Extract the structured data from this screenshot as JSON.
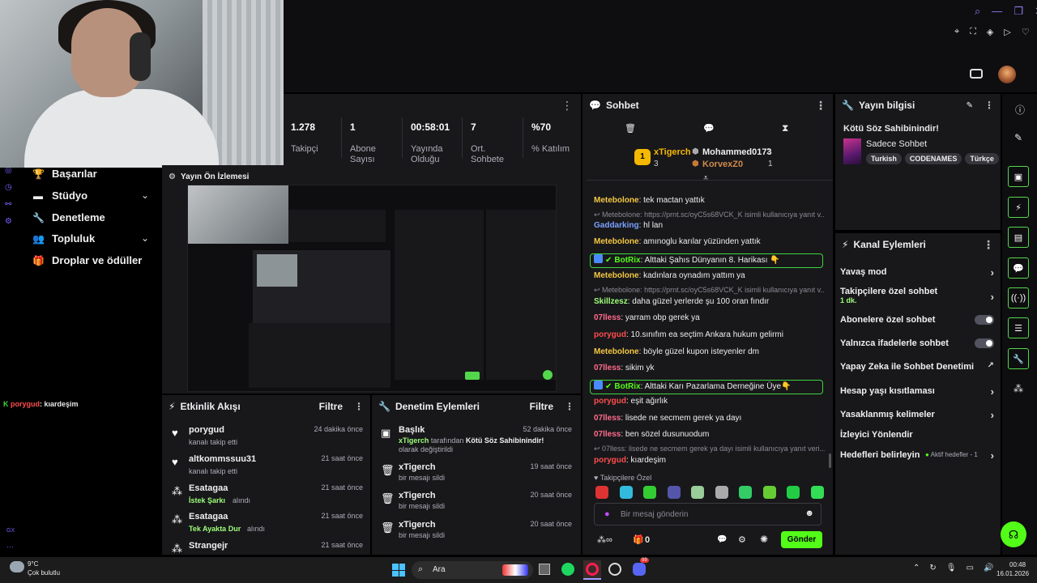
{
  "stats": [
    {
      "value": "1.278",
      "label": "Takipçi"
    },
    {
      "value": "1",
      "label": "Abone Sayısı"
    },
    {
      "value": "00:58:01",
      "label": "Yayında Olduğu"
    },
    {
      "value": "7",
      "label": "Ort. Sohbete"
    },
    {
      "value": "%70",
      "label": "% Katılım"
    }
  ],
  "nav": {
    "items": [
      {
        "label": "Başarılar",
        "icon": "trophy-icon"
      },
      {
        "label": "Stüdyo",
        "icon": "video-icon"
      },
      {
        "label": "Denetleme",
        "icon": "wrench-icon"
      },
      {
        "label": "Topluluk",
        "icon": "people-icon"
      },
      {
        "label": "Droplar ve ödüller",
        "icon": "gift-icon"
      }
    ]
  },
  "preview": {
    "title": "Yayın Ön İzlemesi"
  },
  "overlay_chat": {
    "user": "porygud",
    "text": ": kıardeşim"
  },
  "overlay_small": "GX",
  "activity": {
    "title": "Etkinlik Akışı",
    "filter": "Filtre",
    "rows": [
      {
        "name": "porygud",
        "sub": "kanalı takip etti",
        "time": "24 dakika önce",
        "icon": "heart-icon"
      },
      {
        "name": "altkommssuu31",
        "sub": "kanalı takip etti",
        "time": "21 saat önce",
        "icon": "heart-icon"
      },
      {
        "name": "Esatagaa",
        "sub_green": "İstek Şarkı",
        "sub": "alındı",
        "time": "21 saat önce",
        "icon": "points-icon"
      },
      {
        "name": "Esatagaa",
        "sub_green": "Tek Ayakta Dur",
        "sub": "alındı",
        "time": "21 saat önce",
        "icon": "points-icon"
      },
      {
        "name": "Strangejr",
        "sub": "",
        "time": "21 saat önce",
        "icon": "points-icon"
      }
    ]
  },
  "moderation": {
    "title": "Denetim Eylemleri",
    "filter": "Filtre",
    "rows": [
      {
        "name": "Başlık",
        "user": "xTigerch",
        "mid": " tarafından ",
        "bold": "Kötü Söz Sahibinindir!",
        "end": " olarak değiştirildi",
        "time": "52 dakika önce",
        "icon": "title-icon"
      },
      {
        "name": "xTigerch",
        "sub": "bir mesajı sildi",
        "time": "19 saat önce",
        "icon": "trash-icon"
      },
      {
        "name": "xTigerch",
        "sub": "bir mesajı sildi",
        "time": "20 saat önce",
        "icon": "trash-icon"
      },
      {
        "name": "xTigerch",
        "sub": "bir mesajı sildi",
        "time": "20 saat önce",
        "icon": "trash-icon"
      }
    ]
  },
  "chat": {
    "title": "Sohbet",
    "leaders": {
      "first": "xTigerch",
      "first_count": "3",
      "second": "Mohammed0173",
      "second_count": "2",
      "third": "KorvexZ0",
      "third_count": "1"
    },
    "messages": [
      {
        "user": "Metebolone",
        "color": "#f5c842",
        "text": ": tek mactan yattık"
      },
      {
        "reply": "Metebolone: https://prnt.sc/oyC5s68VCK_K isimli kullanıcıya yanıt v..."
      },
      {
        "user": "Gaddarking",
        "color": "#7aa2ff",
        "text": ": hl lan"
      },
      {
        "user": "Metebolone",
        "color": "#f5c842",
        "text": ": amınoglu karılar yüzünden yattık"
      },
      {
        "bot": "BotRix",
        "text": ": Alttaki Şahıs Dünyanın 8. Harikası 👇"
      },
      {
        "user": "Metebolone",
        "color": "#f5c842",
        "text": ": kadınlara oynadım yattım ya"
      },
      {
        "reply": "Metebolone: https://prnt.sc/oyC5s68VCK_K isimli kullanıcıya yanıt v..."
      },
      {
        "user": "Skillzesz",
        "color": "#9dff7a",
        "text": ": daha güzel yerlerde şu 100 oran fındır"
      },
      {
        "user": "07lless",
        "color": "#ff6b8b",
        "text": ": yarram obp gerek ya"
      },
      {
        "user": "porygud",
        "color": "#ff4d4d",
        "text": ": 10.sınıfım ea seçtim Ankara hukum gelirmi"
      },
      {
        "user": "Metebolone",
        "color": "#f5c842",
        "text": ": böyle güzel kupon isteyenler dm"
      },
      {
        "user": "07lless",
        "color": "#ff6b8b",
        "text": ": sikim yk"
      },
      {
        "bot": "BotRix",
        "text": ": Alttaki Karı Pazarlama Derneğine Üye👇"
      },
      {
        "user": "porygud",
        "color": "#ff4d4d",
        "text": ": eşit ağırlık"
      },
      {
        "user": "07lless",
        "color": "#ff6b8b",
        "text": ": lisede ne secmem gerek ya dayı"
      },
      {
        "user": "07lless",
        "color": "#ff6b8b",
        "text": ": ben sözel dusunuodum"
      },
      {
        "reply": "07lless: lisede ne secmem gerek ya dayı isimli kullanıcıya yanıt veri..."
      },
      {
        "user": "porygud",
        "color": "#ff4d4d",
        "text": ": kıardeşim"
      }
    ],
    "follower_only": "Takipçilere Özel",
    "input_placeholder": "Bir mesaj gönderin",
    "points": "0",
    "send": "Gönder"
  },
  "stream_info": {
    "title": "Yayın bilgisi",
    "stream_title": "Kötü Söz Sahibinindir!",
    "category": "Sadece Sohbet",
    "tags": [
      "Turkish",
      "CODENAMES",
      "Türkçe"
    ]
  },
  "channel_actions": {
    "title": "Kanal Eylemleri",
    "slow": "Yavaş mod",
    "followers": "Takipçilere özel sohbet",
    "followers_sub": "1 dk.",
    "subs": "Abonelere özel sohbet",
    "emotes": "Yalnızca ifadelerle sohbet",
    "ai": "Yapay Zeka ile Sohbet Denetimi",
    "age": "Hesap yaşı kısıtlaması",
    "banned": "Yasaklanmış kelimeler",
    "redirect": "İzleyici Yönlendir",
    "goals": "Hedefleri belirleyin",
    "goals_sub": "Aktif hedefler - 1"
  },
  "taskbar": {
    "weather_temp": "9°C",
    "weather_desc": "Çok bulutlu",
    "search": "Ara",
    "time": "00:48",
    "date": "16.01.2026",
    "badge": "99"
  }
}
